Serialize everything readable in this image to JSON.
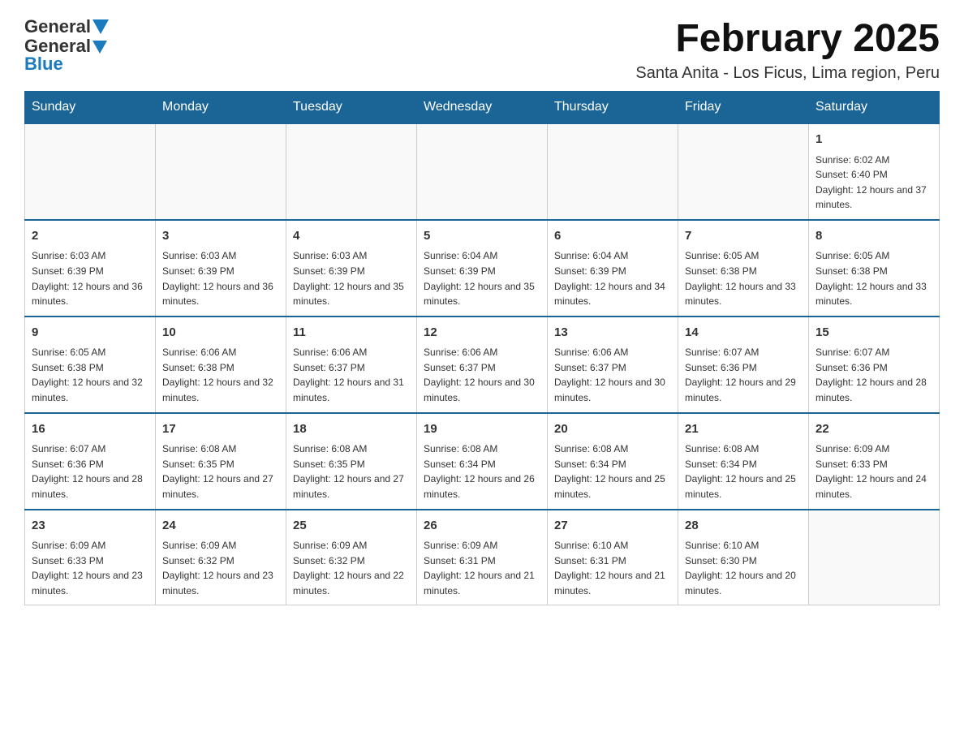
{
  "header": {
    "logo_general": "General",
    "logo_blue": "Blue",
    "month_title": "February 2025",
    "subtitle": "Santa Anita - Los Ficus, Lima region, Peru"
  },
  "weekdays": [
    "Sunday",
    "Monday",
    "Tuesday",
    "Wednesday",
    "Thursday",
    "Friday",
    "Saturday"
  ],
  "weeks": [
    [
      {
        "day": "",
        "info": ""
      },
      {
        "day": "",
        "info": ""
      },
      {
        "day": "",
        "info": ""
      },
      {
        "day": "",
        "info": ""
      },
      {
        "day": "",
        "info": ""
      },
      {
        "day": "",
        "info": ""
      },
      {
        "day": "1",
        "info": "Sunrise: 6:02 AM\nSunset: 6:40 PM\nDaylight: 12 hours and 37 minutes."
      }
    ],
    [
      {
        "day": "2",
        "info": "Sunrise: 6:03 AM\nSunset: 6:39 PM\nDaylight: 12 hours and 36 minutes."
      },
      {
        "day": "3",
        "info": "Sunrise: 6:03 AM\nSunset: 6:39 PM\nDaylight: 12 hours and 36 minutes."
      },
      {
        "day": "4",
        "info": "Sunrise: 6:03 AM\nSunset: 6:39 PM\nDaylight: 12 hours and 35 minutes."
      },
      {
        "day": "5",
        "info": "Sunrise: 6:04 AM\nSunset: 6:39 PM\nDaylight: 12 hours and 35 minutes."
      },
      {
        "day": "6",
        "info": "Sunrise: 6:04 AM\nSunset: 6:39 PM\nDaylight: 12 hours and 34 minutes."
      },
      {
        "day": "7",
        "info": "Sunrise: 6:05 AM\nSunset: 6:38 PM\nDaylight: 12 hours and 33 minutes."
      },
      {
        "day": "8",
        "info": "Sunrise: 6:05 AM\nSunset: 6:38 PM\nDaylight: 12 hours and 33 minutes."
      }
    ],
    [
      {
        "day": "9",
        "info": "Sunrise: 6:05 AM\nSunset: 6:38 PM\nDaylight: 12 hours and 32 minutes."
      },
      {
        "day": "10",
        "info": "Sunrise: 6:06 AM\nSunset: 6:38 PM\nDaylight: 12 hours and 32 minutes."
      },
      {
        "day": "11",
        "info": "Sunrise: 6:06 AM\nSunset: 6:37 PM\nDaylight: 12 hours and 31 minutes."
      },
      {
        "day": "12",
        "info": "Sunrise: 6:06 AM\nSunset: 6:37 PM\nDaylight: 12 hours and 30 minutes."
      },
      {
        "day": "13",
        "info": "Sunrise: 6:06 AM\nSunset: 6:37 PM\nDaylight: 12 hours and 30 minutes."
      },
      {
        "day": "14",
        "info": "Sunrise: 6:07 AM\nSunset: 6:36 PM\nDaylight: 12 hours and 29 minutes."
      },
      {
        "day": "15",
        "info": "Sunrise: 6:07 AM\nSunset: 6:36 PM\nDaylight: 12 hours and 28 minutes."
      }
    ],
    [
      {
        "day": "16",
        "info": "Sunrise: 6:07 AM\nSunset: 6:36 PM\nDaylight: 12 hours and 28 minutes."
      },
      {
        "day": "17",
        "info": "Sunrise: 6:08 AM\nSunset: 6:35 PM\nDaylight: 12 hours and 27 minutes."
      },
      {
        "day": "18",
        "info": "Sunrise: 6:08 AM\nSunset: 6:35 PM\nDaylight: 12 hours and 27 minutes."
      },
      {
        "day": "19",
        "info": "Sunrise: 6:08 AM\nSunset: 6:34 PM\nDaylight: 12 hours and 26 minutes."
      },
      {
        "day": "20",
        "info": "Sunrise: 6:08 AM\nSunset: 6:34 PM\nDaylight: 12 hours and 25 minutes."
      },
      {
        "day": "21",
        "info": "Sunrise: 6:08 AM\nSunset: 6:34 PM\nDaylight: 12 hours and 25 minutes."
      },
      {
        "day": "22",
        "info": "Sunrise: 6:09 AM\nSunset: 6:33 PM\nDaylight: 12 hours and 24 minutes."
      }
    ],
    [
      {
        "day": "23",
        "info": "Sunrise: 6:09 AM\nSunset: 6:33 PM\nDaylight: 12 hours and 23 minutes."
      },
      {
        "day": "24",
        "info": "Sunrise: 6:09 AM\nSunset: 6:32 PM\nDaylight: 12 hours and 23 minutes."
      },
      {
        "day": "25",
        "info": "Sunrise: 6:09 AM\nSunset: 6:32 PM\nDaylight: 12 hours and 22 minutes."
      },
      {
        "day": "26",
        "info": "Sunrise: 6:09 AM\nSunset: 6:31 PM\nDaylight: 12 hours and 21 minutes."
      },
      {
        "day": "27",
        "info": "Sunrise: 6:10 AM\nSunset: 6:31 PM\nDaylight: 12 hours and 21 minutes."
      },
      {
        "day": "28",
        "info": "Sunrise: 6:10 AM\nSunset: 6:30 PM\nDaylight: 12 hours and 20 minutes."
      },
      {
        "day": "",
        "info": ""
      }
    ]
  ]
}
